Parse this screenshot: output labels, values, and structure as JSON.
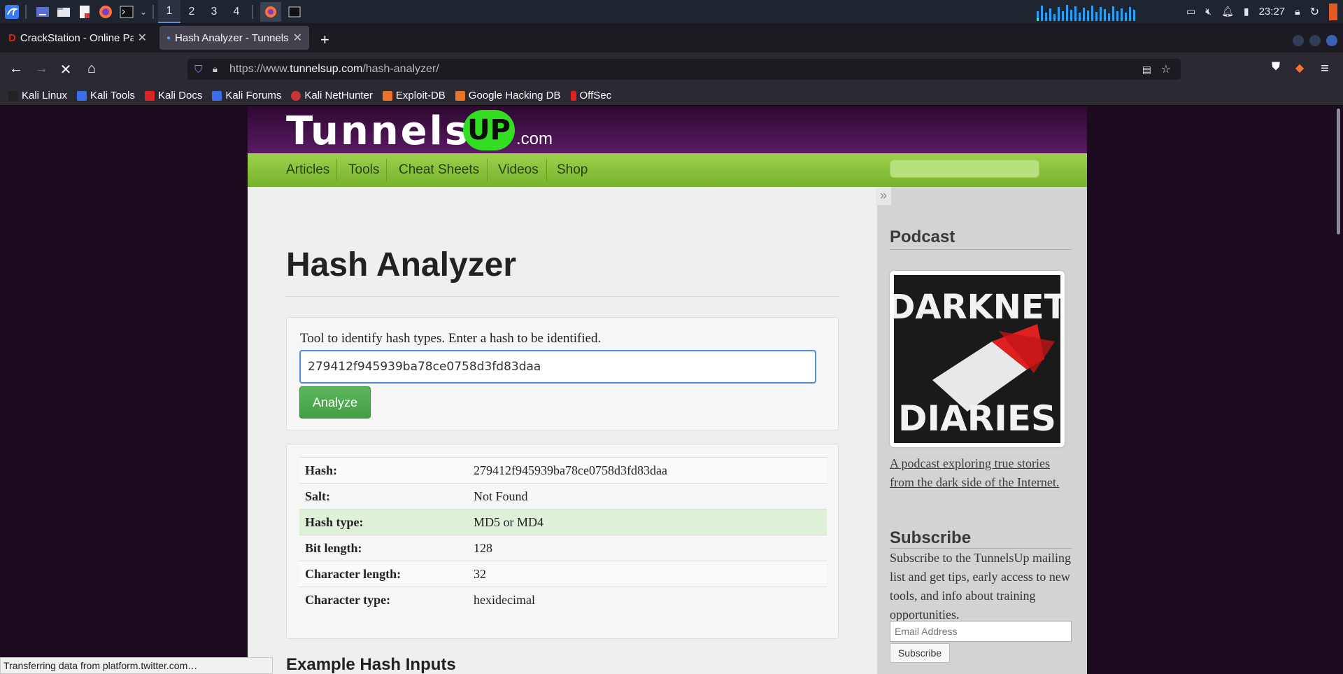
{
  "taskbar": {
    "workspaces": [
      "1",
      "2",
      "3",
      "4"
    ],
    "clock": "23:27"
  },
  "browser": {
    "tabs": [
      {
        "title": "CrackStation - Online Pas",
        "favicon": "crackstation-icon"
      },
      {
        "title": "Hash Analyzer - TunnelsU",
        "favicon": "tunnelsup-icon"
      }
    ],
    "url_prefix": "https://www.",
    "url_domain": "tunnelsup.com",
    "url_path": "/hash-analyzer/",
    "bookmarks": [
      "Kali Linux",
      "Kali Tools",
      "Kali Docs",
      "Kali Forums",
      "Kali NetHunter",
      "Exploit-DB",
      "Google Hacking DB",
      "OffSec"
    ]
  },
  "site": {
    "logo_main": "Tunnels",
    "logo_up": "UP",
    "logo_tld": ".com",
    "menu": [
      "Articles",
      "Tools",
      "Cheat Sheets",
      "Videos",
      "Shop"
    ],
    "sidebar_toggle": "»"
  },
  "page": {
    "title": "Hash Analyzer",
    "intro": "Tool to identify hash types. Enter a hash to be identified.",
    "hash_input_value": "279412f945939ba78ce0758d3fd83daa",
    "analyze_label": "Analyze",
    "results": [
      {
        "label": "Hash:",
        "value": "279412f945939ba78ce0758d3fd83daa"
      },
      {
        "label": "Salt:",
        "value": "Not Found"
      },
      {
        "label": "Hash type:",
        "value": "MD5 or MD4"
      },
      {
        "label": "Bit length:",
        "value": "128"
      },
      {
        "label": "Character length:",
        "value": "32"
      },
      {
        "label": "Character type:",
        "value": "hexidecimal"
      }
    ],
    "examples_heading": "Example Hash Inputs"
  },
  "sidebar": {
    "podcast_heading": "Podcast",
    "podcast_image_text": [
      "DARKNET",
      "DIARIES"
    ],
    "podcast_link": "A podcast exploring true stories from the dark side of the Internet.",
    "subscribe_heading": "Subscribe",
    "subscribe_text": "Subscribe to the TunnelsUp mailing list and get tips, early access to new tools, and info about training opportunities.",
    "email_placeholder": "Email Address",
    "subscribe_button": "Subscribe"
  },
  "status": "Transferring data from platform.twitter.com…"
}
